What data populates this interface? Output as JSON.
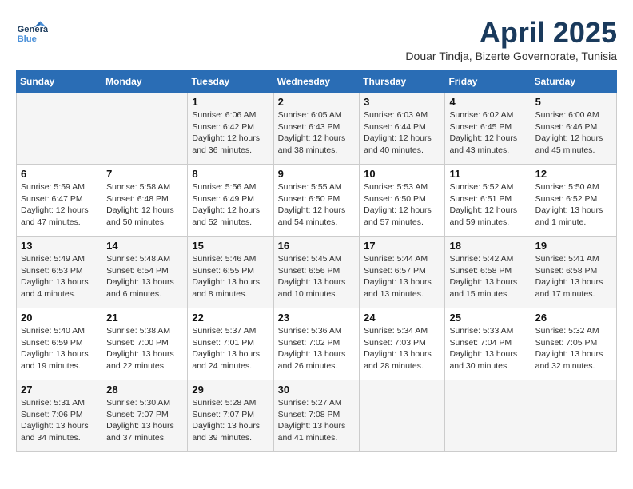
{
  "header": {
    "logo_general": "General",
    "logo_blue": "Blue",
    "month": "April 2025",
    "location": "Douar Tindja, Bizerte Governorate, Tunisia"
  },
  "weekdays": [
    "Sunday",
    "Monday",
    "Tuesday",
    "Wednesday",
    "Thursday",
    "Friday",
    "Saturday"
  ],
  "weeks": [
    [
      {
        "day": "",
        "info": ""
      },
      {
        "day": "",
        "info": ""
      },
      {
        "day": "1",
        "info": "Sunrise: 6:06 AM\nSunset: 6:42 PM\nDaylight: 12 hours\nand 36 minutes."
      },
      {
        "day": "2",
        "info": "Sunrise: 6:05 AM\nSunset: 6:43 PM\nDaylight: 12 hours\nand 38 minutes."
      },
      {
        "day": "3",
        "info": "Sunrise: 6:03 AM\nSunset: 6:44 PM\nDaylight: 12 hours\nand 40 minutes."
      },
      {
        "day": "4",
        "info": "Sunrise: 6:02 AM\nSunset: 6:45 PM\nDaylight: 12 hours\nand 43 minutes."
      },
      {
        "day": "5",
        "info": "Sunrise: 6:00 AM\nSunset: 6:46 PM\nDaylight: 12 hours\nand 45 minutes."
      }
    ],
    [
      {
        "day": "6",
        "info": "Sunrise: 5:59 AM\nSunset: 6:47 PM\nDaylight: 12 hours\nand 47 minutes."
      },
      {
        "day": "7",
        "info": "Sunrise: 5:58 AM\nSunset: 6:48 PM\nDaylight: 12 hours\nand 50 minutes."
      },
      {
        "day": "8",
        "info": "Sunrise: 5:56 AM\nSunset: 6:49 PM\nDaylight: 12 hours\nand 52 minutes."
      },
      {
        "day": "9",
        "info": "Sunrise: 5:55 AM\nSunset: 6:50 PM\nDaylight: 12 hours\nand 54 minutes."
      },
      {
        "day": "10",
        "info": "Sunrise: 5:53 AM\nSunset: 6:50 PM\nDaylight: 12 hours\nand 57 minutes."
      },
      {
        "day": "11",
        "info": "Sunrise: 5:52 AM\nSunset: 6:51 PM\nDaylight: 12 hours\nand 59 minutes."
      },
      {
        "day": "12",
        "info": "Sunrise: 5:50 AM\nSunset: 6:52 PM\nDaylight: 13 hours\nand 1 minute."
      }
    ],
    [
      {
        "day": "13",
        "info": "Sunrise: 5:49 AM\nSunset: 6:53 PM\nDaylight: 13 hours\nand 4 minutes."
      },
      {
        "day": "14",
        "info": "Sunrise: 5:48 AM\nSunset: 6:54 PM\nDaylight: 13 hours\nand 6 minutes."
      },
      {
        "day": "15",
        "info": "Sunrise: 5:46 AM\nSunset: 6:55 PM\nDaylight: 13 hours\nand 8 minutes."
      },
      {
        "day": "16",
        "info": "Sunrise: 5:45 AM\nSunset: 6:56 PM\nDaylight: 13 hours\nand 10 minutes."
      },
      {
        "day": "17",
        "info": "Sunrise: 5:44 AM\nSunset: 6:57 PM\nDaylight: 13 hours\nand 13 minutes."
      },
      {
        "day": "18",
        "info": "Sunrise: 5:42 AM\nSunset: 6:58 PM\nDaylight: 13 hours\nand 15 minutes."
      },
      {
        "day": "19",
        "info": "Sunrise: 5:41 AM\nSunset: 6:58 PM\nDaylight: 13 hours\nand 17 minutes."
      }
    ],
    [
      {
        "day": "20",
        "info": "Sunrise: 5:40 AM\nSunset: 6:59 PM\nDaylight: 13 hours\nand 19 minutes."
      },
      {
        "day": "21",
        "info": "Sunrise: 5:38 AM\nSunset: 7:00 PM\nDaylight: 13 hours\nand 22 minutes."
      },
      {
        "day": "22",
        "info": "Sunrise: 5:37 AM\nSunset: 7:01 PM\nDaylight: 13 hours\nand 24 minutes."
      },
      {
        "day": "23",
        "info": "Sunrise: 5:36 AM\nSunset: 7:02 PM\nDaylight: 13 hours\nand 26 minutes."
      },
      {
        "day": "24",
        "info": "Sunrise: 5:34 AM\nSunset: 7:03 PM\nDaylight: 13 hours\nand 28 minutes."
      },
      {
        "day": "25",
        "info": "Sunrise: 5:33 AM\nSunset: 7:04 PM\nDaylight: 13 hours\nand 30 minutes."
      },
      {
        "day": "26",
        "info": "Sunrise: 5:32 AM\nSunset: 7:05 PM\nDaylight: 13 hours\nand 32 minutes."
      }
    ],
    [
      {
        "day": "27",
        "info": "Sunrise: 5:31 AM\nSunset: 7:06 PM\nDaylight: 13 hours\nand 34 minutes."
      },
      {
        "day": "28",
        "info": "Sunrise: 5:30 AM\nSunset: 7:07 PM\nDaylight: 13 hours\nand 37 minutes."
      },
      {
        "day": "29",
        "info": "Sunrise: 5:28 AM\nSunset: 7:07 PM\nDaylight: 13 hours\nand 39 minutes."
      },
      {
        "day": "30",
        "info": "Sunrise: 5:27 AM\nSunset: 7:08 PM\nDaylight: 13 hours\nand 41 minutes."
      },
      {
        "day": "",
        "info": ""
      },
      {
        "day": "",
        "info": ""
      },
      {
        "day": "",
        "info": ""
      }
    ]
  ]
}
